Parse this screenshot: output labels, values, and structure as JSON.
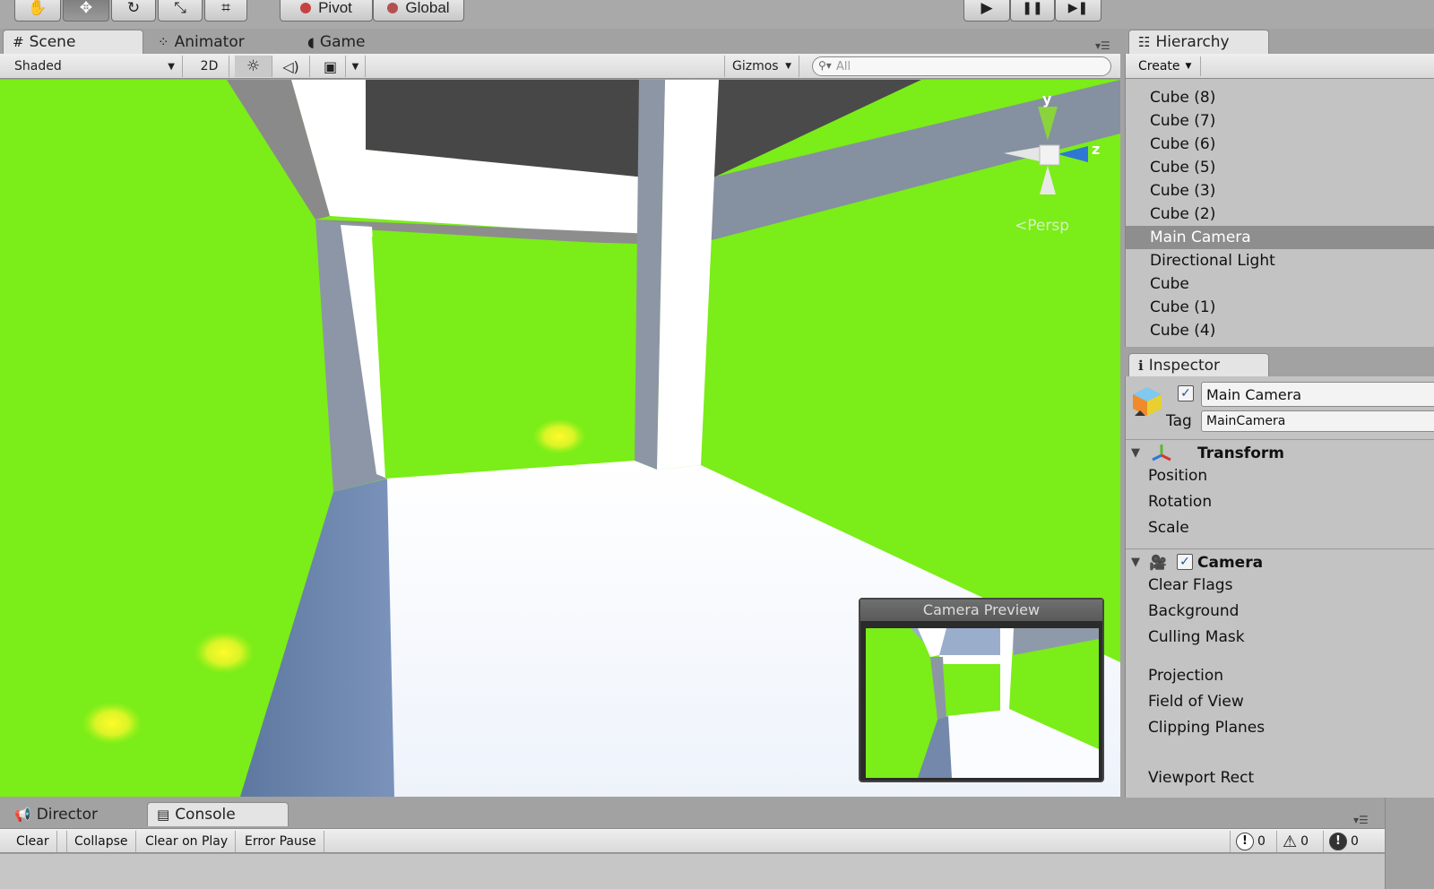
{
  "toolbar": {
    "tools": [
      {
        "name": "hand-tool",
        "icon": "✋"
      },
      {
        "name": "move-tool",
        "icon": "✥"
      },
      {
        "name": "rotate-tool",
        "icon": "↻"
      },
      {
        "name": "scale-tool",
        "icon": "⤡"
      },
      {
        "name": "rect-tool",
        "icon": "⌗"
      }
    ],
    "pivot_label": "Pivot",
    "global_label": "Global",
    "play_icon": "▶",
    "pause_icon": "❚❚",
    "step_icon": "▶❚"
  },
  "scene_tabs": {
    "scene": "Scene",
    "animator": "Animator",
    "game": "Game"
  },
  "scene_toolbar": {
    "shading_mode": "Shaded",
    "mode_2d": "2D",
    "lighting_icon": "☼",
    "audio_icon": "🔊",
    "effects_icon": "▣",
    "gizmos_label": "Gizmos",
    "search_placeholder": "All"
  },
  "scene_view": {
    "projection_label": "Persp",
    "axis_y": "y",
    "axis_z": "z",
    "camera_preview_title": "Camera Preview"
  },
  "hierarchy": {
    "tab_label": "Hierarchy",
    "create_label": "Create",
    "items": [
      {
        "label": "Cube (8)",
        "selected": false
      },
      {
        "label": "Cube (7)",
        "selected": false
      },
      {
        "label": "Cube (6)",
        "selected": false
      },
      {
        "label": "Cube (5)",
        "selected": false
      },
      {
        "label": "Cube (3)",
        "selected": false
      },
      {
        "label": "Cube (2)",
        "selected": false
      },
      {
        "label": "Main Camera",
        "selected": true
      },
      {
        "label": "Directional Light",
        "selected": false
      },
      {
        "label": "Cube",
        "selected": false
      },
      {
        "label": "Cube (1)",
        "selected": false
      },
      {
        "label": "Cube (4)",
        "selected": false
      }
    ]
  },
  "inspector": {
    "tab_label": "Inspector",
    "object_name": "Main Camera",
    "tag_label": "Tag",
    "tag_value": "MainCamera",
    "transform": {
      "title": "Transform",
      "properties": [
        "Position",
        "Rotation",
        "Scale"
      ]
    },
    "camera": {
      "title": "Camera",
      "properties": [
        "Clear Flags",
        "Background",
        "Culling Mask",
        "Projection",
        "Field of View",
        "Clipping Planes",
        "Viewport Rect"
      ]
    }
  },
  "bottom": {
    "director_tab": "Director",
    "console_tab": "Console",
    "buttons": [
      "Clear",
      "Collapse",
      "Clear on Play",
      "Error Pause"
    ],
    "counts": {
      "info": "0",
      "warnings": "0",
      "errors": "0"
    },
    "info_symbol": "!",
    "warning_symbol": "⚠",
    "error_symbol": "!"
  },
  "colors": {
    "green_wall": "#7bed18",
    "selection": "#8e8e8e",
    "panel_bg": "#c3c3c3"
  }
}
